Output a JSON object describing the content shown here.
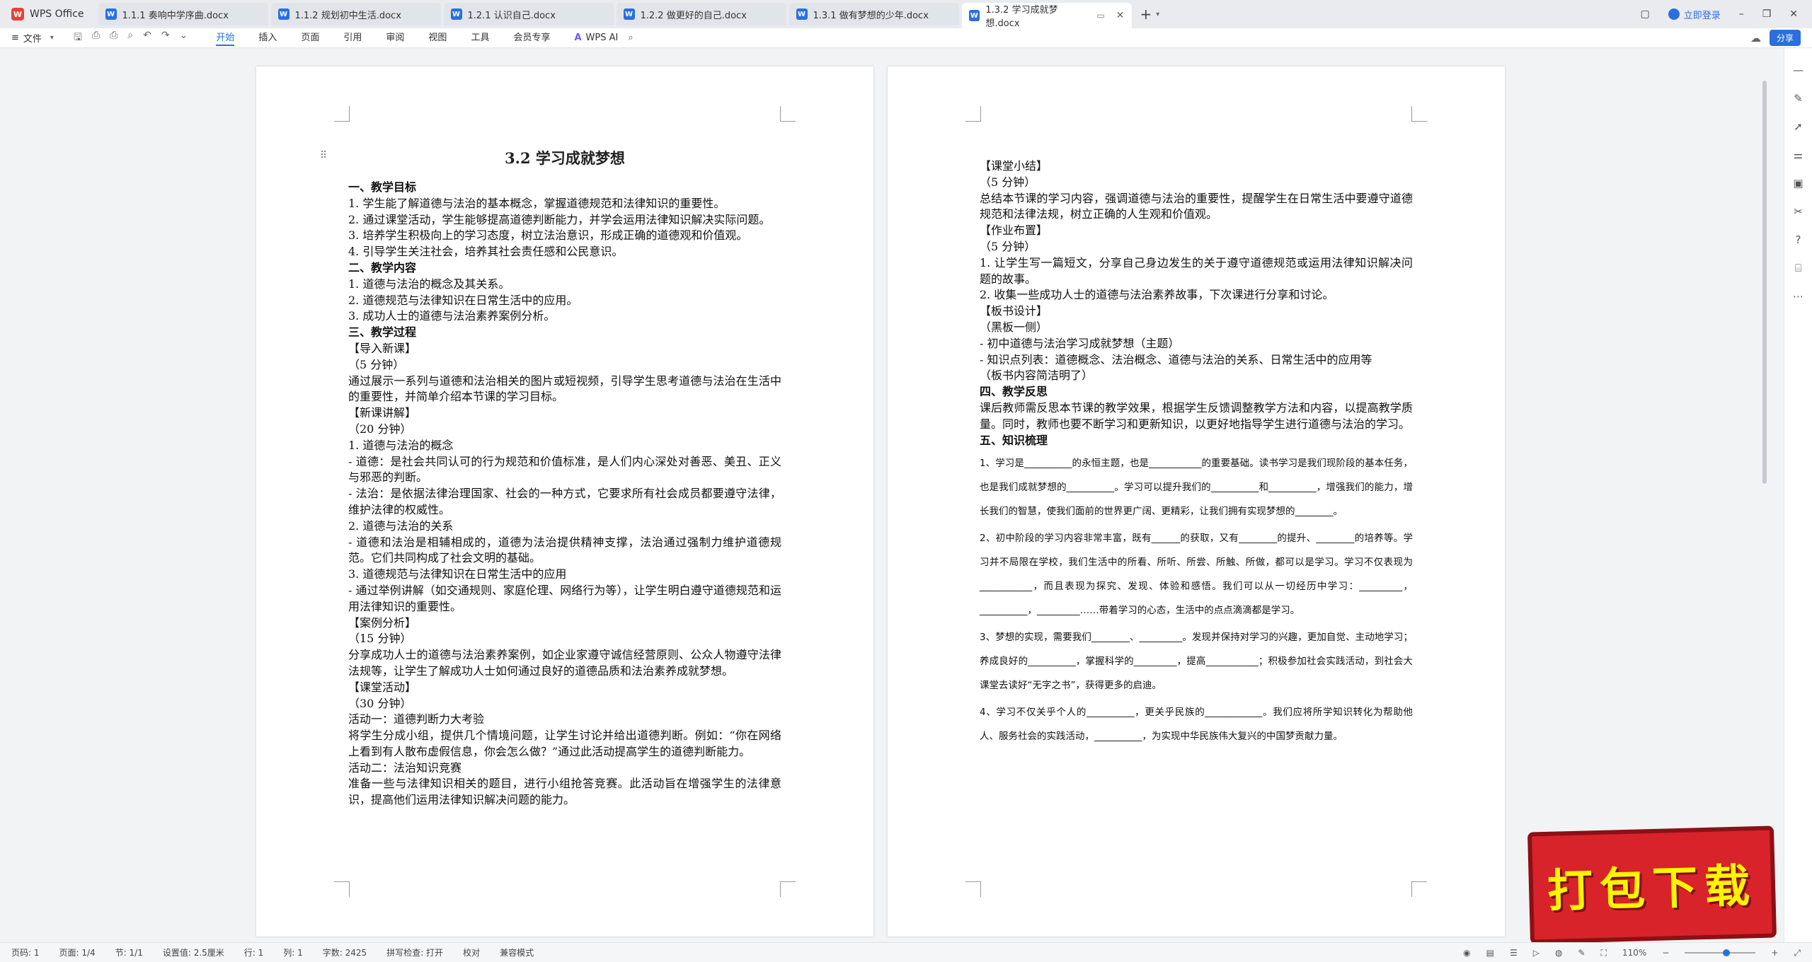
{
  "app": {
    "name": "WPS Office",
    "logo": "W"
  },
  "tabs": [
    {
      "label": "1.1.1 奏响中学序曲.docx",
      "active": false
    },
    {
      "label": "1.1.2 规划初中生活.docx",
      "active": false
    },
    {
      "label": "1.2.1 认识自己.docx",
      "active": false
    },
    {
      "label": "1.2.2 做更好的自己.docx",
      "active": false
    },
    {
      "label": "1.3.1 做有梦想的少年.docx",
      "active": false
    },
    {
      "label": "1.3.2 学习成就梦想.docx",
      "active": true
    }
  ],
  "tab_doc_icon": "W",
  "topright": {
    "login": "立即登录"
  },
  "toolbar": {
    "file": "文件",
    "ribbon_tabs": [
      "开始",
      "插入",
      "页面",
      "引用",
      "审阅",
      "视图",
      "工具",
      "会员专享"
    ],
    "ai": "WPS AI",
    "share": "分享"
  },
  "page1": {
    "title": "3.2 学习成就梦想",
    "paragraphs": [
      {
        "text": "一、教学目标",
        "bold": true
      },
      {
        "text": "1. 学生能了解道德与法治的基本概念，掌握道德规范和法律知识的重要性。"
      },
      {
        "text": "2. 通过课堂活动，学生能够提高道德判断能力，并学会运用法律知识解决实际问题。"
      },
      {
        "text": "3. 培养学生积极向上的学习态度，树立法治意识，形成正确的道德观和价值观。"
      },
      {
        "text": "4. 引导学生关注社会，培养其社会责任感和公民意识。"
      },
      {
        "text": "二、教学内容",
        "bold": true
      },
      {
        "text": "1. 道德与法治的概念及其关系。"
      },
      {
        "text": "2. 道德规范与法律知识在日常生活中的应用。"
      },
      {
        "text": "3. 成功人士的道德与法治素养案例分析。"
      },
      {
        "text": "三、教学过程",
        "bold": true
      },
      {
        "text": "【导入新课】"
      },
      {
        "text": "（5 分钟）"
      },
      {
        "text": "通过展示一系列与道德和法治相关的图片或短视频，引导学生思考道德与法治在生活中的重要性，并简单介绍本节课的学习目标。"
      },
      {
        "text": "【新课讲解】"
      },
      {
        "text": "（20 分钟）"
      },
      {
        "text": "1. 道德与法治的概念"
      },
      {
        "text": "- 道德：是社会共同认可的行为规范和价值标准，是人们内心深处对善恶、美丑、正义与邪恶的判断。"
      },
      {
        "text": "- 法治：是依据法律治理国家、社会的一种方式，它要求所有社会成员都要遵守法律，维护法律的权威性。"
      },
      {
        "text": "2. 道德与法治的关系"
      },
      {
        "text": "- 道德和法治是相辅相成的，道德为法治提供精神支撑，法治通过强制力维护道德规范。它们共同构成了社会文明的基础。"
      },
      {
        "text": "3. 道德规范与法律知识在日常生活中的应用"
      },
      {
        "text": "- 通过举例讲解（如交通规则、家庭伦理、网络行为等），让学生明白遵守道德规范和运用法律知识的重要性。"
      },
      {
        "text": "【案例分析】"
      },
      {
        "text": "（15 分钟）"
      },
      {
        "text": "分享成功人士的道德与法治素养案例，如企业家遵守诚信经营原则、公众人物遵守法律法规等，让学生了解成功人士如何通过良好的道德品质和法治素养成就梦想。"
      },
      {
        "text": "【课堂活动】"
      },
      {
        "text": "（30 分钟）"
      },
      {
        "text": "活动一：道德判断力大考验"
      },
      {
        "text": "将学生分成小组，提供几个情境问题，让学生讨论并给出道德判断。例如：“你在网络上看到有人散布虚假信息，你会怎么做？”通过此活动提高学生的道德判断能力。"
      },
      {
        "text": "活动二：法治知识竞赛"
      },
      {
        "text": "准备一些与法律知识相关的题目，进行小组抢答竞赛。此活动旨在增强学生的法律意识，提高他们运用法律知识解决问题的能力。"
      }
    ]
  },
  "page2": {
    "paragraphs": [
      {
        "text": "【课堂小结】"
      },
      {
        "text": "（5 分钟）"
      },
      {
        "text": "总结本节课的学习内容，强调道德与法治的重要性，提醒学生在日常生活中要遵守道德规范和法律法规，树立正确的人生观和价值观。"
      },
      {
        "text": "【作业布置】"
      },
      {
        "text": "（5 分钟）"
      },
      {
        "text": "1. 让学生写一篇短文，分享自己身边发生的关于遵守道德规范或运用法律知识解决问题的故事。"
      },
      {
        "text": "2. 收集一些成功人士的道德与法治素养故事，下次课进行分享和讨论。"
      },
      {
        "text": "【板书设计】"
      },
      {
        "text": "（黑板一侧）"
      },
      {
        "text": "- 初中道德与法治学习成就梦想（主题）"
      },
      {
        "text": "- 知识点列表：道德概念、法治概念、道德与法治的关系、日常生活中的应用等"
      },
      {
        "text": "（板书内容简洁明了）"
      },
      {
        "text": "四、教学反思",
        "bold": true
      },
      {
        "text": "课后教师需反思本节课的教学效果，根据学生反馈调整教学方法和内容，以提高教学质量。同时，教师也要不断学习和更新知识，以更好地指导学生进行道德与法治的学习。"
      },
      {
        "text": "五、知识梳理",
        "bold": true
      }
    ],
    "knowledge": [
      "1、学习是__________的永恒主题，也是___________的重要基础。读书学习是我们现阶段的基本任务，也是我们成就梦想的__________。学习可以提升我们的__________和__________，增强我们的能力，增长我们的智慧，使我们面前的世界更广阔、更精彩，让我们拥有实现梦想的________。",
      "2、初中阶段的学习内容非常丰富，既有______的获取，又有________的提升、________的培养等。学习并不局限在学校，我们生活中的所看、所听、所尝、所触、所做，都可以是学习。学习不仅表现为___________，而且表现为探究、发现、体验和感悟。我们可以从一切经历中学习：_________，__________，_________……带着学习的心态，生活中的点点滴滴都是学习。",
      "3、梦想的实现，需要我们________、_________。发现并保持对学习的兴趣，更加自觉、主动地学习；养成良好的__________，掌握科学的_________，提高___________；积极参加社会实践活动，到社会大课堂去读好“无字之书”，获得更多的启迪。",
      "4、学习不仅关乎个人的__________，更关乎民族的____________。我们应将所学知识转化为帮助他人、服务社会的实践活动，__________，为实现中华民族伟大复兴的中国梦贡献力量。"
    ]
  },
  "banner": {
    "text": "打包下载"
  },
  "statusbar": {
    "page": "页码: 1",
    "pages": "页面: 1/4",
    "section": "节: 1/1",
    "setting": "设置值: 2.5厘米",
    "row": "行: 1",
    "col": "列: 1",
    "words": "字数: 2425",
    "spell": "拼写检查: 打开",
    "proof": "校对",
    "compat": "兼容模式",
    "zoom": "110%"
  },
  "colors": {
    "accent": "#2b6fde",
    "banner": "#d8232a",
    "banner_text": "#fff400"
  }
}
